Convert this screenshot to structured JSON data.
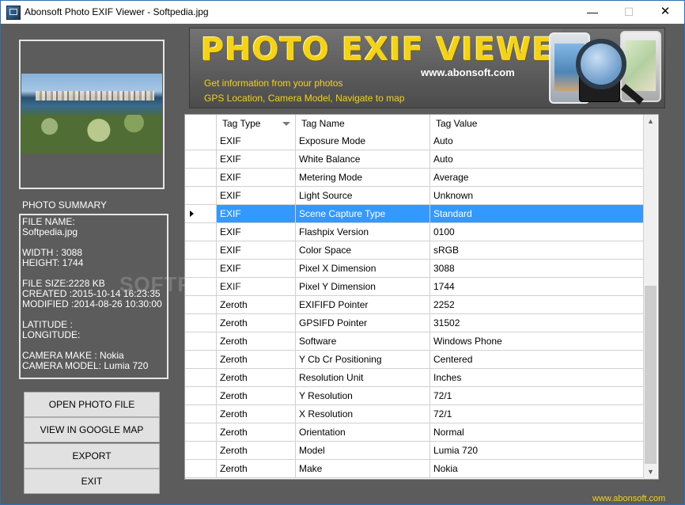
{
  "window": {
    "title": "Abonsoft Photo EXIF Viewer - Softpedia.jpg",
    "minimize_glyph": "—",
    "maximize_glyph": "☐",
    "close_glyph": "✕"
  },
  "summary": {
    "label": "PHOTO SUMMARY",
    "lines": [
      "FILE NAME:",
      "Softpedia.jpg",
      "",
      "WIDTH : 3088",
      "HEIGHT: 1744",
      "",
      "FILE SIZE:2228 KB",
      "CREATED  :2015-10-14 16:23:35",
      "MODIFIED :2014-08-26 10:30:00",
      "",
      "LATITUDE :",
      "LONGITUDE:",
      "",
      "CAMERA MAKE : Nokia",
      "CAMERA MODEL: Lumia 720"
    ]
  },
  "buttons": {
    "open": "OPEN PHOTO FILE",
    "map": "VIEW IN GOOGLE MAP",
    "export": "EXPORT",
    "exit": "EXIT"
  },
  "banner": {
    "title": "PHOTO EXIF VIEWER",
    "url": "www.abonsoft.com",
    "tagline1": "Get information from your photos",
    "tagline2": "GPS Location, Camera Model, Navigate to map"
  },
  "grid": {
    "columns": [
      "Tag Type",
      "Tag Name",
      "Tag Value"
    ],
    "selected_index": 4,
    "rows": [
      [
        "EXIF",
        "Exposure Mode",
        "Auto"
      ],
      [
        "EXIF",
        "White Balance",
        "Auto"
      ],
      [
        "EXIF",
        "Metering Mode",
        "Average"
      ],
      [
        "EXIF",
        "Light Source",
        "Unknown"
      ],
      [
        "EXIF",
        "Scene Capture Type",
        "Standard"
      ],
      [
        "EXIF",
        "Flashpix Version",
        "0100"
      ],
      [
        "EXIF",
        "Color Space",
        "sRGB"
      ],
      [
        "EXIF",
        "Pixel X Dimension",
        "3088"
      ],
      [
        "EXIF",
        "Pixel Y Dimension",
        "1744"
      ],
      [
        "Zeroth",
        "EXIFIFD Pointer",
        "2252"
      ],
      [
        "Zeroth",
        "GPSIFD Pointer",
        "31502"
      ],
      [
        "Zeroth",
        "Software",
        "Windows Phone"
      ],
      [
        "Zeroth",
        "Y Cb Cr Positioning",
        "Centered"
      ],
      [
        "Zeroth",
        "Resolution Unit",
        "Inches"
      ],
      [
        "Zeroth",
        "Y Resolution",
        "72/1"
      ],
      [
        "Zeroth",
        "X Resolution",
        "72/1"
      ],
      [
        "Zeroth",
        "Orientation",
        "Normal"
      ],
      [
        "Zeroth",
        "Model",
        "Lumia 720"
      ],
      [
        "Zeroth",
        "Make",
        "Nokia"
      ]
    ]
  },
  "footer_link": "www.abonsoft.com",
  "watermark": "SOFTPEDIA",
  "colors": {
    "window_bg": "#5c5c5c",
    "banner_yellow": "#f3d21c",
    "selection": "#3399ff"
  }
}
